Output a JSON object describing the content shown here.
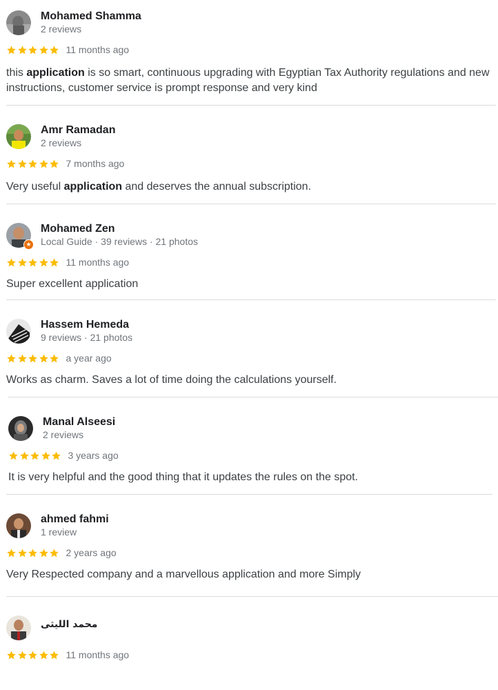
{
  "colors": {
    "star": "#fbbc04",
    "name": "#202124",
    "meta": "#70757a",
    "divider": "#dadce0",
    "badge": "#e8710a"
  },
  "icons": {
    "star": "star-icon",
    "avatar": "user-avatar",
    "guide_badge": "local-guide-badge-icon"
  },
  "reviews": [
    {
      "name": "Mohamed Shamma",
      "meta": "2 reviews",
      "rating": 5,
      "date": "11 months ago",
      "text_before": "this ",
      "highlight": "application",
      "text_after": " is so smart, continuous upgrading with Egyptian Tax Authority regulations and new instructions, customer service is prompt response and very kind"
    },
    {
      "name": "Amr Ramadan",
      "meta": "2 reviews",
      "rating": 5,
      "date": "7 months ago",
      "text_before": "Very useful ",
      "highlight": "application",
      "text_after": " and deserves the annual subscription."
    },
    {
      "name": "Mohamed Zen",
      "meta": "Local Guide · 39 reviews · 21 photos",
      "rating": 5,
      "date": "11 months ago",
      "text": "Super excellent application"
    },
    {
      "name": "Hassem Hemeda",
      "meta": "9 reviews · 21 photos",
      "rating": 5,
      "date": "a year ago",
      "text": "Works as charm. Saves a lot of time doing the calculations yourself."
    },
    {
      "name": "Manal Alseesi",
      "meta": "2 reviews",
      "rating": 5,
      "date": "3 years ago",
      "text": "It is very helpful and the good thing that it updates the rules on the spot."
    },
    {
      "name": "ahmed fahmi",
      "meta": "1 review",
      "rating": 5,
      "date": "2 years ago",
      "text": "Very Respected company and a marvellous application and more Simply"
    },
    {
      "name": "محمد الليثى",
      "rating": 5,
      "date": "11 months ago"
    }
  ]
}
